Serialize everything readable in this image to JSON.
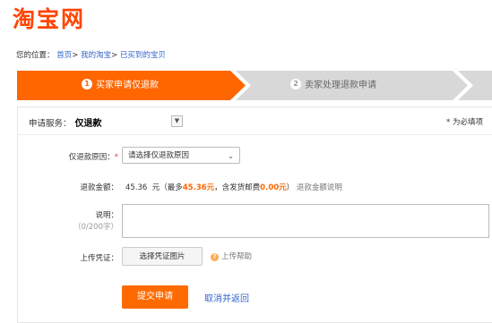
{
  "logo": {
    "text": "淘宝网"
  },
  "breadcrumb": {
    "prefix": "您的位置：",
    "items": [
      "首页",
      "我的淘宝",
      "已买到的宝贝"
    ],
    "sep": ">"
  },
  "steps": [
    {
      "num": "1",
      "label": "买家申请仅退款",
      "active": true
    },
    {
      "num": "2",
      "label": "卖家处理退款申请",
      "active": false
    }
  ],
  "colors": {
    "accent": "#ff6600",
    "step_active": "#ff6600",
    "step_inactive": "#d8d8d8",
    "link": "#3366cc"
  },
  "form": {
    "service_label": "申请服务：",
    "service_value": "仅退款",
    "required_note": "* 为必填项",
    "reason_label": "仅退款原因：",
    "reason_placeholder": "请选择仅退款原因",
    "amount_label": "退款金额：",
    "amount_value": "45.36",
    "amount_unit": "元（最多",
    "amount_max": "45.36元",
    "amount_shipping": "，含发货邮费",
    "amount_shipping_value": "0.00元",
    "amount_close": "）",
    "amount_help": "退款金额说明",
    "note_label": "说明：",
    "note_limit": "（0/200字）",
    "upload_label": "上传凭证：",
    "upload_button": "选择凭证图片",
    "upload_help": "上传帮助",
    "submit_button": "提交申请",
    "cancel_link": "取消并返回"
  }
}
